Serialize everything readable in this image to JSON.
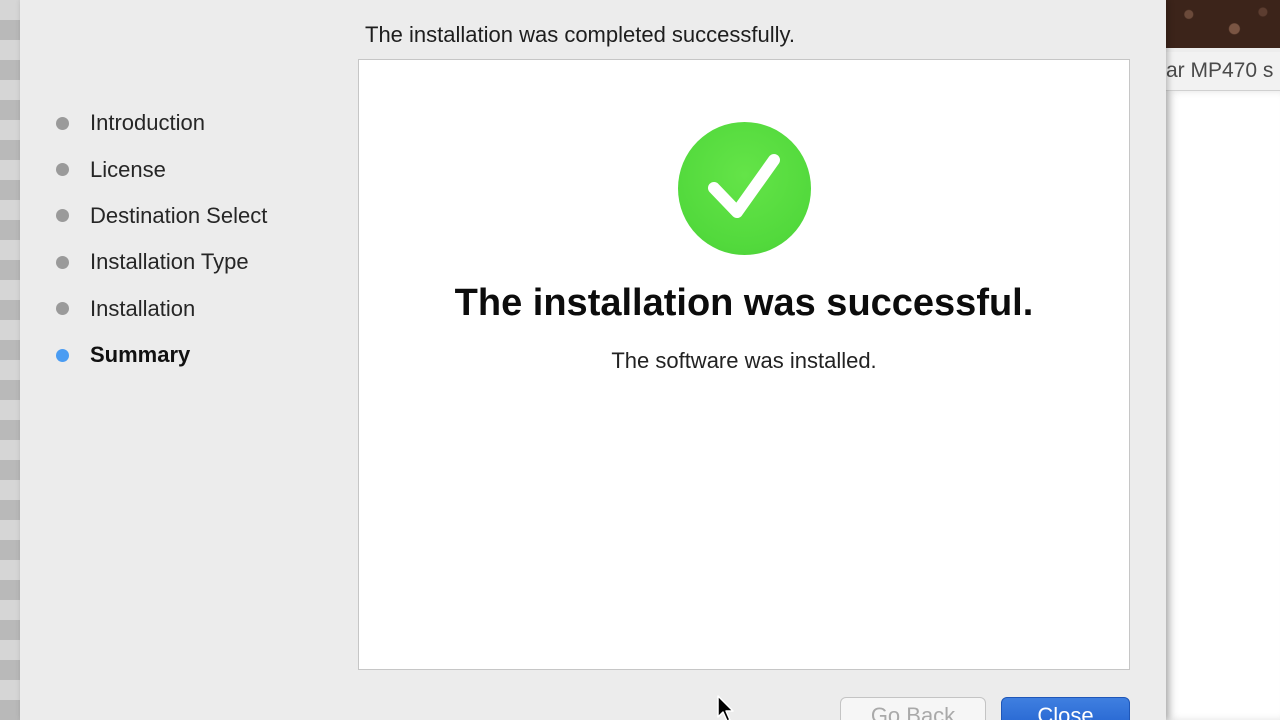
{
  "header": {
    "status_text": "The installation was completed successfully."
  },
  "steps": [
    {
      "label": "Introduction",
      "active": false
    },
    {
      "label": "License",
      "active": false
    },
    {
      "label": "Destination Select",
      "active": false
    },
    {
      "label": "Installation Type",
      "active": false
    },
    {
      "label": "Installation",
      "active": false
    },
    {
      "label": "Summary",
      "active": true
    }
  ],
  "content": {
    "icon": "checkmark-circle-icon",
    "title": "The installation was successful.",
    "subtitle": "The software was installed."
  },
  "buttons": {
    "go_back": "Go Back",
    "close": "Close"
  },
  "background_window": {
    "title_fragment": "ar MP470 s"
  },
  "colors": {
    "accent": "#4a9cf2",
    "success": "#52d93c",
    "close_button": "#2a6bd6"
  }
}
